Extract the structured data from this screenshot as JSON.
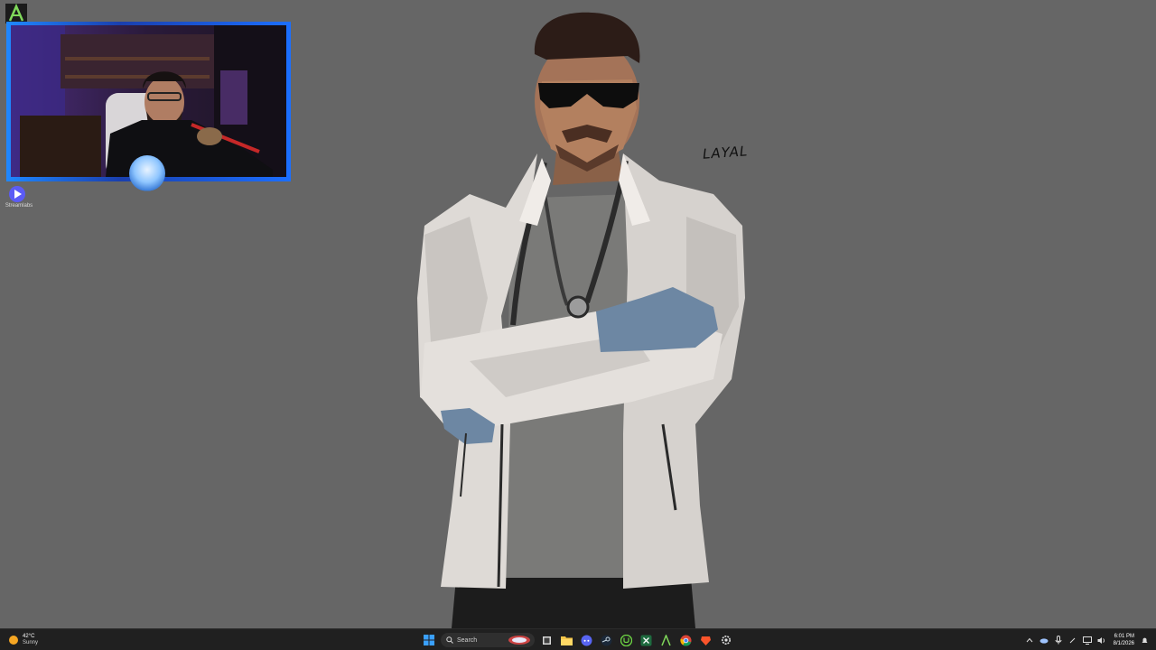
{
  "desktop": {
    "wallpaper_signature": "LAYAL",
    "icons": [
      {
        "name": "streamlabs",
        "label": "Streamlabs"
      }
    ]
  },
  "taskbar": {
    "weather": {
      "temp": "42°C",
      "condition": "Sunny"
    },
    "search_placeholder": "Search",
    "pinned": [
      "start-icon",
      "search",
      "task-view-icon",
      "file-explorer-icon",
      "discord-icon",
      "steam-icon",
      "upwork-icon",
      "excel-icon",
      "app-a-icon",
      "chrome-icon",
      "brave-icon",
      "settings-icon"
    ],
    "clock": {
      "time": "6:01 PM",
      "date": "8/1/2026"
    }
  },
  "colors": {
    "desktop_bg": "#666666",
    "taskbar_bg": "#202020",
    "webcam_border": "#1f88ff",
    "accent_green": "#7fd85a"
  }
}
